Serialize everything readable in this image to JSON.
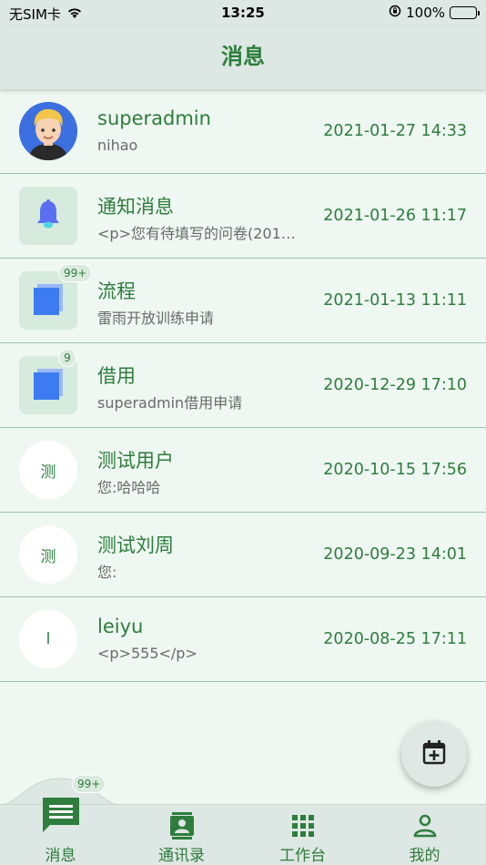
{
  "status_bar": {
    "carrier": "无SIM卡",
    "time": "13:25",
    "battery": "100%"
  },
  "header": {
    "title": "消息"
  },
  "conversations": [
    {
      "name": "superadmin",
      "preview": "nihao",
      "time": "2021-01-27 14:33",
      "avatar_type": "photo",
      "avatar_text": "",
      "badge": ""
    },
    {
      "name": "通知消息",
      "preview": "<p>您有待填写的问卷(201…",
      "time": "2021-01-26 11:17",
      "avatar_type": "bell",
      "avatar_text": "",
      "badge": ""
    },
    {
      "name": "流程",
      "preview": "雷雨开放训练申请",
      "time": "2021-01-13 11:11",
      "avatar_type": "docs",
      "avatar_text": "",
      "badge": "99+"
    },
    {
      "name": "借用",
      "preview": "superadmin借用申请",
      "time": "2020-12-29 17:10",
      "avatar_type": "docs",
      "avatar_text": "",
      "badge": "9"
    },
    {
      "name": "测试用户",
      "preview": "您:哈哈哈",
      "time": "2020-10-15 17:56",
      "avatar_type": "text",
      "avatar_text": "测",
      "badge": ""
    },
    {
      "name": "测试刘周",
      "preview": "您:",
      "time": "2020-09-23 14:01",
      "avatar_type": "text",
      "avatar_text": "测",
      "badge": ""
    },
    {
      "name": "leiyu",
      "preview": "<p>555</p>",
      "time": "2020-08-25 17:11",
      "avatar_type": "text",
      "avatar_text": "l",
      "badge": ""
    }
  ],
  "fab": {
    "icon": "calendar-add-icon"
  },
  "tabbar": {
    "badge": "99+",
    "tabs": [
      {
        "label": "消息",
        "icon": "message-icon"
      },
      {
        "label": "通讯录",
        "icon": "contacts-icon"
      },
      {
        "label": "工作台",
        "icon": "grid-icon"
      },
      {
        "label": "我的",
        "icon": "person-icon"
      }
    ]
  },
  "colors": {
    "accent": "#2e7d3c",
    "background": "#eef7f2",
    "bar": "#dde7e3",
    "icon_blue": "#3d7bf0"
  }
}
